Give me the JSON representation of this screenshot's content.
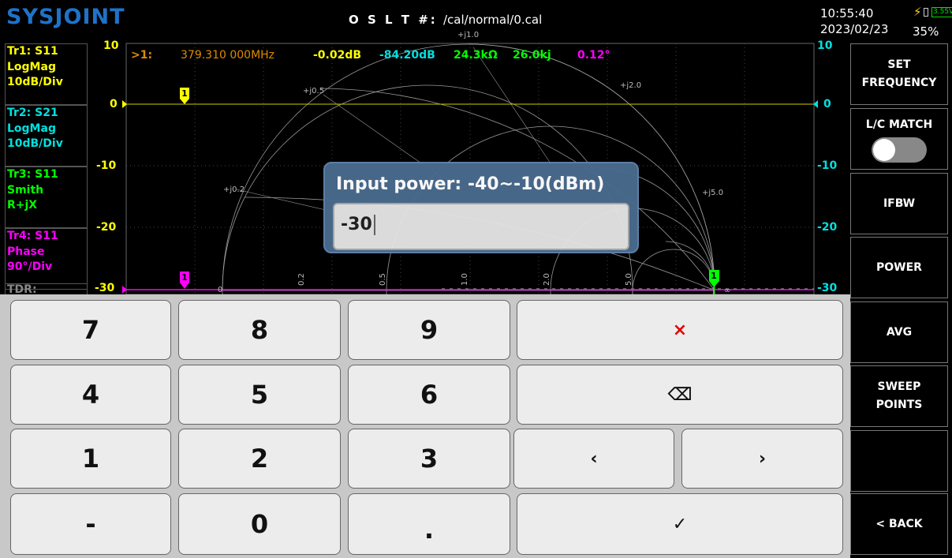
{
  "header": {
    "logo": "SYSJOINT",
    "cal_label": "O S L T #:",
    "cal_path": "/cal/normal/0.cal",
    "time": "10:55:40",
    "date": "2023/02/23",
    "battery_voltage": "3.55V",
    "battery_percent": "35%"
  },
  "traces": [
    {
      "name": "Tr1:  S11",
      "format": "LogMag",
      "scale": "10dB/Div",
      "color": "#ffff00"
    },
    {
      "name": "Tr2:  S21",
      "format": "LogMag",
      "scale": "10dB/Div",
      "color": "#00e0e0"
    },
    {
      "name": "Tr3:  S11",
      "format": "Smith",
      "scale": "R+jX",
      "color": "#00ff00"
    },
    {
      "name": "Tr4:  S11",
      "format": "Phase",
      "scale": "90°/Div",
      "color": "#ff00ff"
    },
    {
      "name": "TDR:",
      "color": "#888888"
    }
  ],
  "marker": {
    "label": ">1:",
    "frequency": "379.310 000MHz",
    "tr1_value": "-0.02dB",
    "tr2_value": "-84.20dB",
    "tr3_r": "24.3kΩ",
    "tr3_x": "26.0kj",
    "tr4_value": "0.12°",
    "marker_num": "1"
  },
  "y_axis_left": {
    "top": "10",
    "ref": "0",
    "m10": "-10",
    "m20": "-20",
    "m30": "-30"
  },
  "y_axis_right": {
    "top": "10",
    "ref": "0",
    "m10": "-10",
    "m20": "-20",
    "m30": "-30"
  },
  "smith_labels": {
    "j1": "+j1.0",
    "j05": "+j0.5",
    "j2": "+j2.0",
    "j02": "+j0.2",
    "j5": "+j5.0",
    "r0": "0",
    "r02": "0.2",
    "r05": "0.5",
    "r1": "1.0",
    "r2": "2.0",
    "r5": "5.0",
    "rinf": "∞"
  },
  "dialog": {
    "title": "Input power: -40~-10(dBm)",
    "value": "-30"
  },
  "keypad": {
    "k7": "7",
    "k8": "8",
    "k9": "9",
    "k4": "4",
    "k5": "5",
    "k6": "6",
    "k1": "1",
    "k2": "2",
    "k3": "3",
    "kminus": "-",
    "k0": "0",
    "kdot": ".",
    "clear": "×",
    "backspace": "⌫",
    "left": "‹",
    "right": "›",
    "enter": "✓"
  },
  "menu": {
    "set_frequency_1": "SET",
    "set_frequency_2": "FREQUENCY",
    "lc_match": "L/C MATCH",
    "ifbw": "IFBW",
    "power": "POWER",
    "avg": "AVG",
    "sweep_points_1": "SWEEP",
    "sweep_points_2": "POINTS",
    "back": "< BACK"
  },
  "colors": {
    "tr1": "#ffff00",
    "tr2": "#00e0e0",
    "tr3": "#00ff00",
    "tr4": "#ff00ff",
    "freq": "#e08a00",
    "logo": "#1e73c8",
    "dialog": "#4a6b8e"
  }
}
